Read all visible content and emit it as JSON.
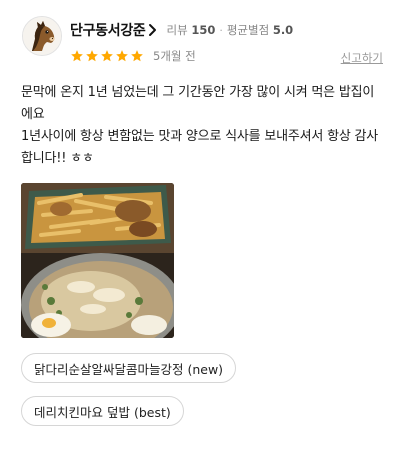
{
  "reviewer": {
    "nickname": "단구동서강준",
    "review_count_label": "리뷰",
    "review_count": "150",
    "avg_rating_label": "평균별점",
    "avg_rating": "5.0",
    "avatar_icon": "horse-avatar-icon"
  },
  "rating": {
    "stars": 5,
    "max_stars": 5,
    "star_color": "#ffa800"
  },
  "time_ago": "5개월 전",
  "report_label": "신고하기",
  "review_text": "문막에 온지 1년 넘었는데 그 기간동안 가장 많이 시켜 먹은 밥집이에요\n1년사이에 항상 변함없는 맛과 양으로 식사를 보내주셔서 항상 감사합니다!! ㅎㅎ",
  "menu_tags": [
    "닭다리순살알싸달콤마늘강정 (new)",
    "데리치킨마요 덮밥 (best)"
  ]
}
